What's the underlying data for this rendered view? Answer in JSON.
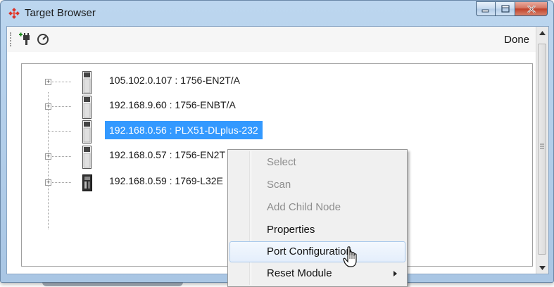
{
  "window": {
    "title": "Target Browser",
    "icon": "plx-diamond-icon"
  },
  "toolbar": {
    "add_label_icon": "add-plug-icon",
    "scan_icon": "gauge-icon",
    "done_label": "Done"
  },
  "tree": {
    "nodes": [
      {
        "label": "105.102.0.107 : 1756-EN2T/A",
        "expandable": true,
        "selected": false,
        "icon": "rack-module-icon"
      },
      {
        "label": "192.168.9.60 : 1756-ENBT/A",
        "expandable": true,
        "selected": false,
        "icon": "rack-module-icon"
      },
      {
        "label": "192.168.0.56 : PLX51-DLplus-232",
        "expandable": false,
        "selected": true,
        "icon": "rack-module-icon"
      },
      {
        "label": "192.168.0.57 : 1756-EN2T",
        "expandable": true,
        "selected": false,
        "icon": "rack-module-icon"
      },
      {
        "label": "192.168.0.59 : 1769-L32E",
        "expandable": true,
        "selected": false,
        "icon": "compactlogix-icon"
      }
    ]
  },
  "context_menu": {
    "items": [
      {
        "label": "Select",
        "enabled": false
      },
      {
        "label": "Scan",
        "enabled": false
      },
      {
        "label": "Add Child Node",
        "enabled": false
      },
      {
        "label": "Properties",
        "enabled": true
      },
      {
        "label": "Port Configuration",
        "enabled": true,
        "hovered": true
      },
      {
        "label": "Reset Module",
        "enabled": true,
        "submenu": true
      }
    ]
  },
  "colors": {
    "selection": "#3399ff",
    "close_button": "#c0412a",
    "title_bar": "#bcd6ef"
  }
}
